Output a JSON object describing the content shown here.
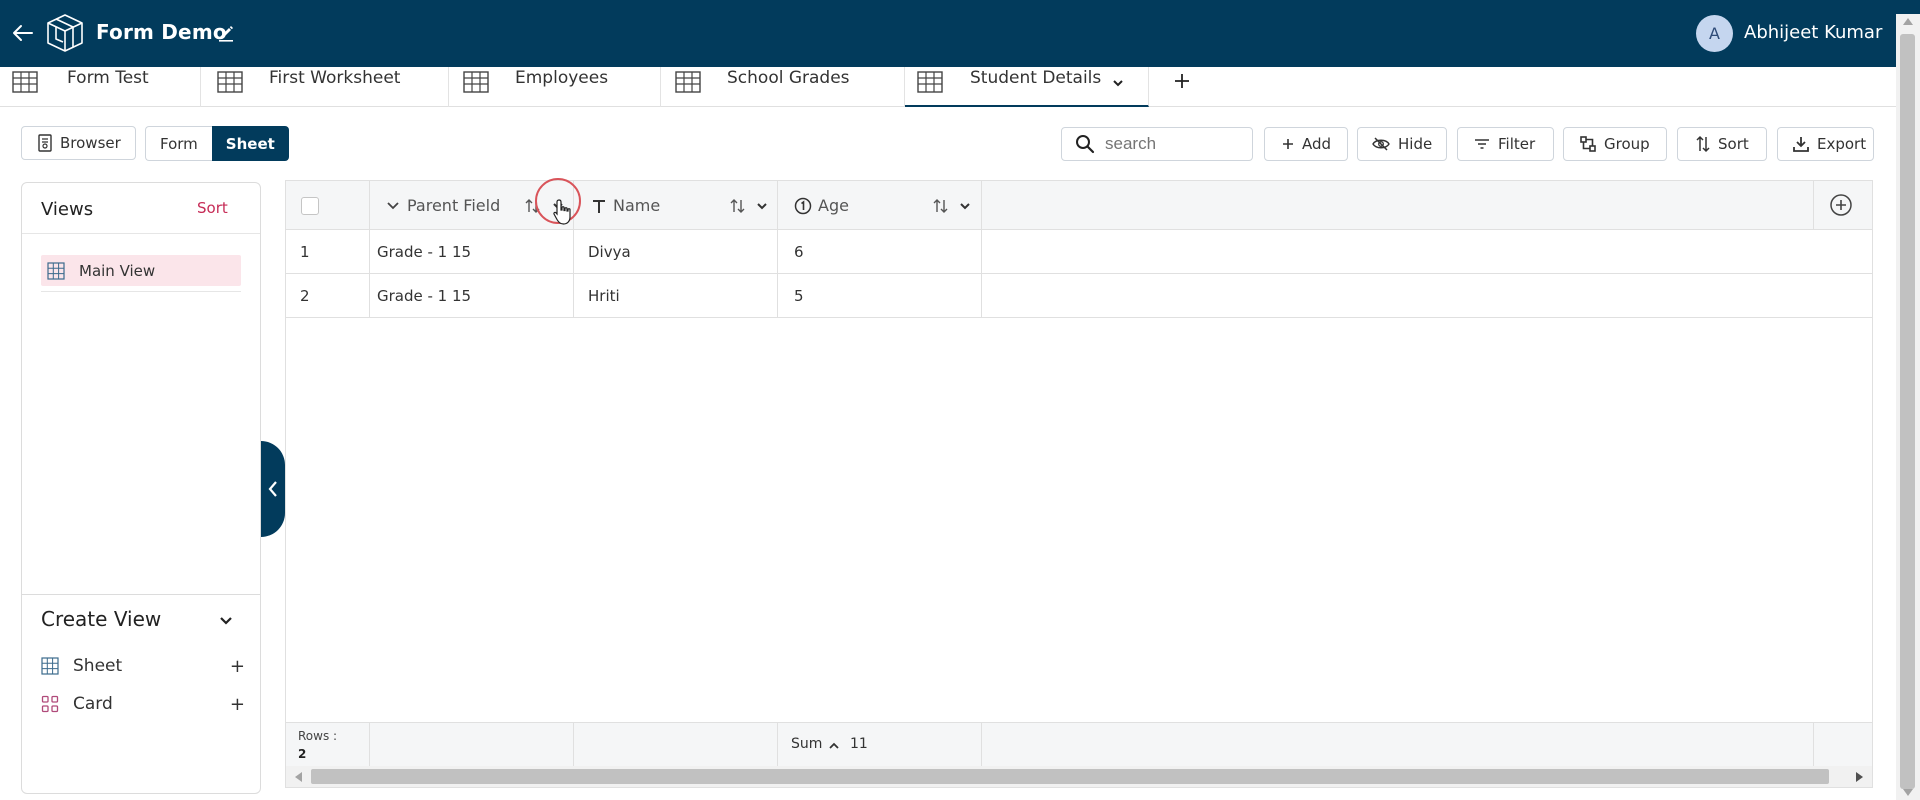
{
  "header": {
    "app_title": "Form Demo",
    "user_initial": "A",
    "user_name": "Abhijeet Kumar",
    "bg_color": "#023b5c"
  },
  "tabs": [
    {
      "label": "Form Test"
    },
    {
      "label": "First Worksheet"
    },
    {
      "label": "Employees"
    },
    {
      "label": "School Grades"
    },
    {
      "label": "Student Details",
      "active": true
    }
  ],
  "toolbar": {
    "browser_label": "Browser",
    "form_label": "Form",
    "sheet_label": "Sheet",
    "search_placeholder": "search",
    "add_label": "Add",
    "hide_label": "Hide",
    "filter_label": "Filter",
    "group_label": "Group",
    "sort_label": "Sort",
    "export_label": "Export"
  },
  "views_panel": {
    "title": "Views",
    "sort_label": "Sort",
    "views": [
      {
        "label": "Main View",
        "selected": true
      }
    ],
    "create_title": "Create View",
    "create_items": [
      {
        "label": "Sheet",
        "icon": "grid-icon"
      },
      {
        "label": "Card",
        "icon": "card-icon"
      }
    ]
  },
  "grid": {
    "columns": [
      {
        "label": "Parent Field",
        "icon": "chevron-down-icon"
      },
      {
        "label": "Name",
        "icon": "text-type-icon"
      },
      {
        "label": "Age",
        "icon": "number-type-icon"
      }
    ],
    "rows": [
      {
        "index": "1",
        "parent_field": "Grade - 1 15",
        "name": "Divya",
        "age": "6"
      },
      {
        "index": "2",
        "parent_field": "Grade - 1 15",
        "name": "Hriti",
        "age": "5"
      }
    ],
    "footer": {
      "rows_label": "Rows :",
      "rows_count": "2",
      "sum_label": "Sum",
      "sum_value": "11"
    }
  },
  "colors": {
    "primary": "#023b5c",
    "accent": "#c62b56",
    "selected_view_bg": "#fbe5ea"
  }
}
